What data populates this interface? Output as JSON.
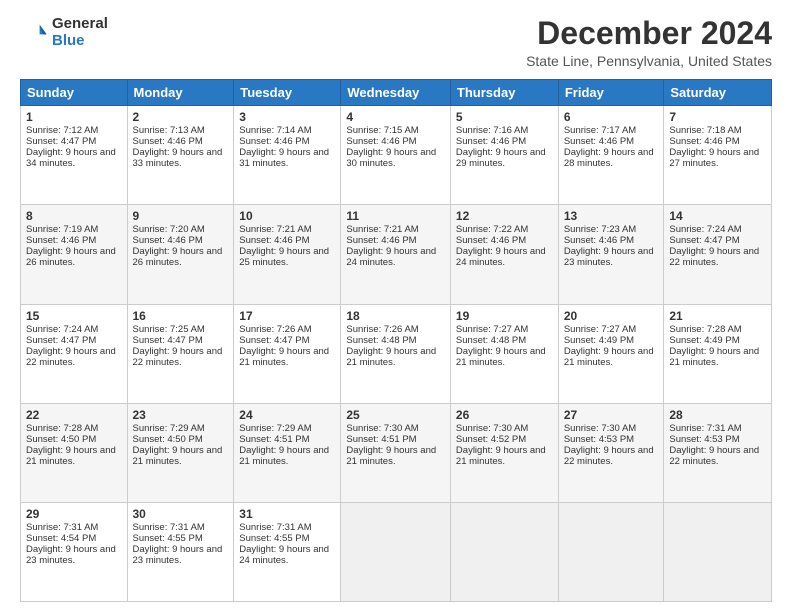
{
  "header": {
    "logo_general": "General",
    "logo_blue": "Blue",
    "title": "December 2024",
    "subtitle": "State Line, Pennsylvania, United States"
  },
  "days_of_week": [
    "Sunday",
    "Monday",
    "Tuesday",
    "Wednesday",
    "Thursday",
    "Friday",
    "Saturday"
  ],
  "weeks": [
    [
      {
        "day": "1",
        "sunrise": "7:12 AM",
        "sunset": "4:47 PM",
        "daylight": "9 hours and 34 minutes."
      },
      {
        "day": "2",
        "sunrise": "7:13 AM",
        "sunset": "4:46 PM",
        "daylight": "9 hours and 33 minutes."
      },
      {
        "day": "3",
        "sunrise": "7:14 AM",
        "sunset": "4:46 PM",
        "daylight": "9 hours and 31 minutes."
      },
      {
        "day": "4",
        "sunrise": "7:15 AM",
        "sunset": "4:46 PM",
        "daylight": "9 hours and 30 minutes."
      },
      {
        "day": "5",
        "sunrise": "7:16 AM",
        "sunset": "4:46 PM",
        "daylight": "9 hours and 29 minutes."
      },
      {
        "day": "6",
        "sunrise": "7:17 AM",
        "sunset": "4:46 PM",
        "daylight": "9 hours and 28 minutes."
      },
      {
        "day": "7",
        "sunrise": "7:18 AM",
        "sunset": "4:46 PM",
        "daylight": "9 hours and 27 minutes."
      }
    ],
    [
      {
        "day": "8",
        "sunrise": "7:19 AM",
        "sunset": "4:46 PM",
        "daylight": "9 hours and 26 minutes."
      },
      {
        "day": "9",
        "sunrise": "7:20 AM",
        "sunset": "4:46 PM",
        "daylight": "9 hours and 26 minutes."
      },
      {
        "day": "10",
        "sunrise": "7:21 AM",
        "sunset": "4:46 PM",
        "daylight": "9 hours and 25 minutes."
      },
      {
        "day": "11",
        "sunrise": "7:21 AM",
        "sunset": "4:46 PM",
        "daylight": "9 hours and 24 minutes."
      },
      {
        "day": "12",
        "sunrise": "7:22 AM",
        "sunset": "4:46 PM",
        "daylight": "9 hours and 24 minutes."
      },
      {
        "day": "13",
        "sunrise": "7:23 AM",
        "sunset": "4:46 PM",
        "daylight": "9 hours and 23 minutes."
      },
      {
        "day": "14",
        "sunrise": "7:24 AM",
        "sunset": "4:47 PM",
        "daylight": "9 hours and 22 minutes."
      }
    ],
    [
      {
        "day": "15",
        "sunrise": "7:24 AM",
        "sunset": "4:47 PM",
        "daylight": "9 hours and 22 minutes."
      },
      {
        "day": "16",
        "sunrise": "7:25 AM",
        "sunset": "4:47 PM",
        "daylight": "9 hours and 22 minutes."
      },
      {
        "day": "17",
        "sunrise": "7:26 AM",
        "sunset": "4:47 PM",
        "daylight": "9 hours and 21 minutes."
      },
      {
        "day": "18",
        "sunrise": "7:26 AM",
        "sunset": "4:48 PM",
        "daylight": "9 hours and 21 minutes."
      },
      {
        "day": "19",
        "sunrise": "7:27 AM",
        "sunset": "4:48 PM",
        "daylight": "9 hours and 21 minutes."
      },
      {
        "day": "20",
        "sunrise": "7:27 AM",
        "sunset": "4:49 PM",
        "daylight": "9 hours and 21 minutes."
      },
      {
        "day": "21",
        "sunrise": "7:28 AM",
        "sunset": "4:49 PM",
        "daylight": "9 hours and 21 minutes."
      }
    ],
    [
      {
        "day": "22",
        "sunrise": "7:28 AM",
        "sunset": "4:50 PM",
        "daylight": "9 hours and 21 minutes."
      },
      {
        "day": "23",
        "sunrise": "7:29 AM",
        "sunset": "4:50 PM",
        "daylight": "9 hours and 21 minutes."
      },
      {
        "day": "24",
        "sunrise": "7:29 AM",
        "sunset": "4:51 PM",
        "daylight": "9 hours and 21 minutes."
      },
      {
        "day": "25",
        "sunrise": "7:30 AM",
        "sunset": "4:51 PM",
        "daylight": "9 hours and 21 minutes."
      },
      {
        "day": "26",
        "sunrise": "7:30 AM",
        "sunset": "4:52 PM",
        "daylight": "9 hours and 21 minutes."
      },
      {
        "day": "27",
        "sunrise": "7:30 AM",
        "sunset": "4:53 PM",
        "daylight": "9 hours and 22 minutes."
      },
      {
        "day": "28",
        "sunrise": "7:31 AM",
        "sunset": "4:53 PM",
        "daylight": "9 hours and 22 minutes."
      }
    ],
    [
      {
        "day": "29",
        "sunrise": "7:31 AM",
        "sunset": "4:54 PM",
        "daylight": "9 hours and 23 minutes."
      },
      {
        "day": "30",
        "sunrise": "7:31 AM",
        "sunset": "4:55 PM",
        "daylight": "9 hours and 23 minutes."
      },
      {
        "day": "31",
        "sunrise": "7:31 AM",
        "sunset": "4:55 PM",
        "daylight": "9 hours and 24 minutes."
      },
      null,
      null,
      null,
      null
    ]
  ],
  "labels": {
    "sunrise": "Sunrise:",
    "sunset": "Sunset:",
    "daylight": "Daylight:"
  }
}
